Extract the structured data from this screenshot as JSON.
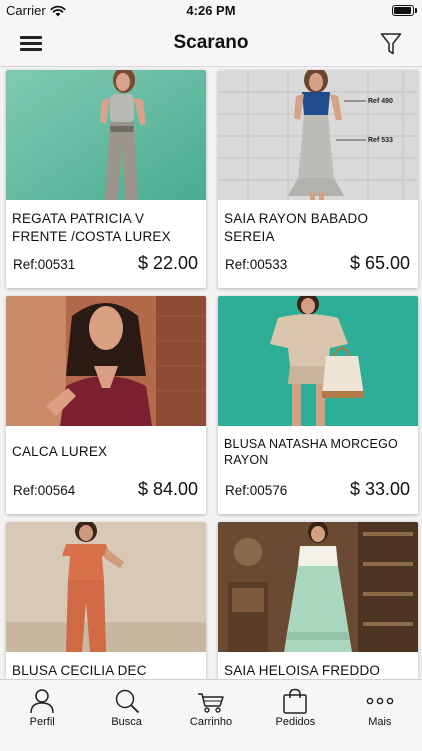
{
  "status_bar": {
    "carrier": "Carrier",
    "time": "4:26 PM",
    "battery_level": 0.95
  },
  "header": {
    "title": "Scarano",
    "menu_icon": "hamburger-menu-icon",
    "filter_icon": "filter-icon"
  },
  "products": [
    {
      "name": "REGATA PATRICIA V FRENTE /COSTA LUREX",
      "ref": "Ref:00531",
      "price": "$ 22.00"
    },
    {
      "name": "SAIA RAYON BABADO SEREIA",
      "ref": "Ref:00533",
      "price": "$ 65.00",
      "image_tags": [
        "Ref 490",
        "Ref 533"
      ]
    },
    {
      "name": "CALCA LUREX",
      "ref": "Ref:00564",
      "price": "$ 84.00"
    },
    {
      "name": "BLUSA NATASHA MORCEGO RAYON",
      "ref": "Ref:00576",
      "price": "$ 33.00"
    },
    {
      "name": "BLUSA CECILIA DEC",
      "ref": "",
      "price": ""
    },
    {
      "name": "SAIA HELOISA FREDDO",
      "ref": "",
      "price": ""
    }
  ],
  "tabbar": {
    "items": [
      {
        "label": "Perfil",
        "icon": "person-icon"
      },
      {
        "label": "Busca",
        "icon": "search-icon"
      },
      {
        "label": "Carrinho",
        "icon": "cart-icon"
      },
      {
        "label": "Pedidos",
        "icon": "bag-icon"
      },
      {
        "label": "Mais",
        "icon": "more-dots-icon"
      }
    ]
  }
}
